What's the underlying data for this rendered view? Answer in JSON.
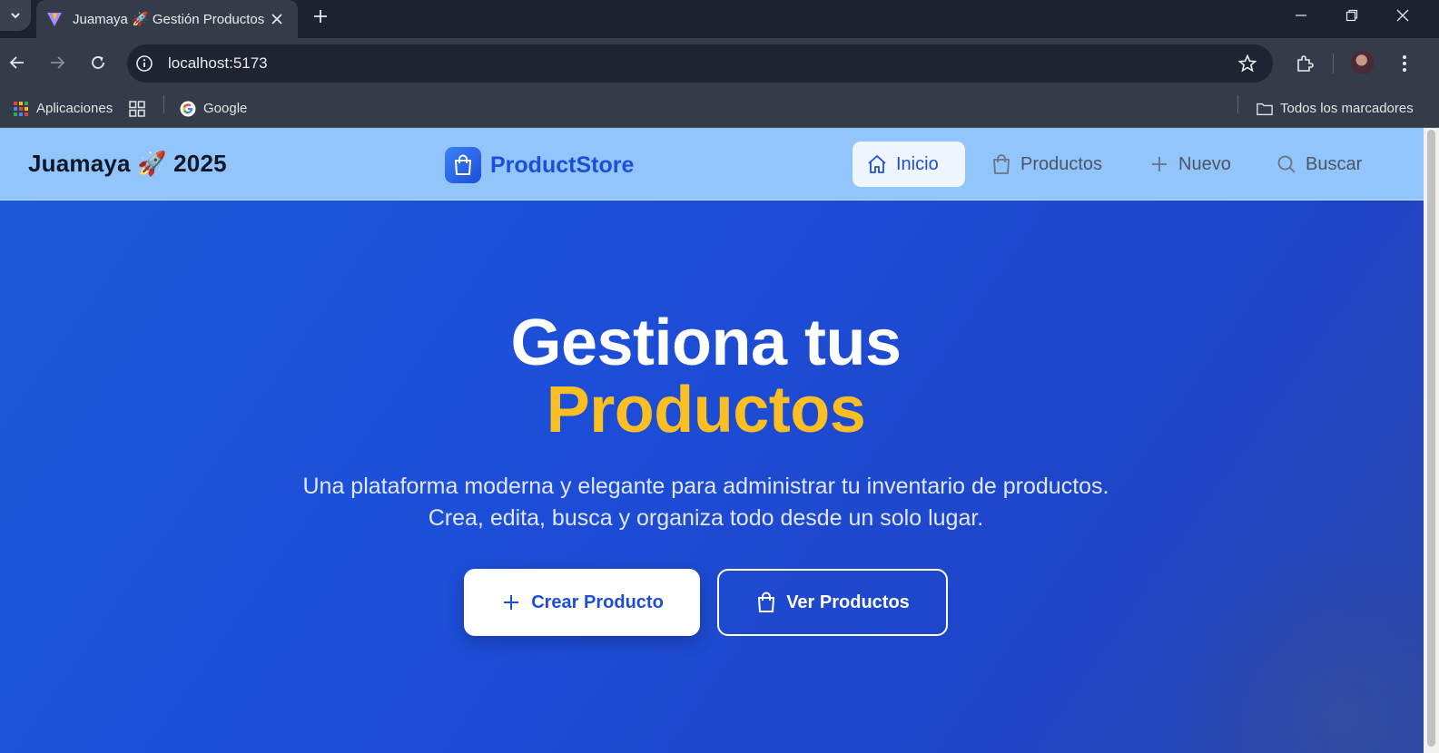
{
  "browser": {
    "tab_title": "Juamaya 🚀 Gestión Productos",
    "url": "localhost:5173",
    "bookmarks": {
      "apps": "Aplicaciones",
      "google": "Google",
      "all": "Todos los marcadores"
    }
  },
  "navbar": {
    "brand": "Juamaya 🚀 2025",
    "logo_text": "ProductStore",
    "links": [
      {
        "label": "Inicio",
        "icon": "home-icon",
        "active": true
      },
      {
        "label": "Productos",
        "icon": "shopping-bag-icon",
        "active": false
      },
      {
        "label": "Nuevo",
        "icon": "plus-icon",
        "active": false
      },
      {
        "label": "Buscar",
        "icon": "search-icon",
        "active": false
      }
    ]
  },
  "hero": {
    "title_line1": "Gestiona tus",
    "title_line2": "Productos",
    "subtitle_line1": "Una plataforma moderna y elegante para administrar tu inventario de productos.",
    "subtitle_line2": "Crea, edita, busca y organiza todo desde un solo lugar.",
    "primary_button": "Crear Producto",
    "secondary_button": "Ver Productos"
  },
  "colors": {
    "hero_bg": "#1d4ed8",
    "navbar_bg": "#93c5fd",
    "accent": "#fbbf24",
    "brand_blue": "#1d4ed8"
  }
}
